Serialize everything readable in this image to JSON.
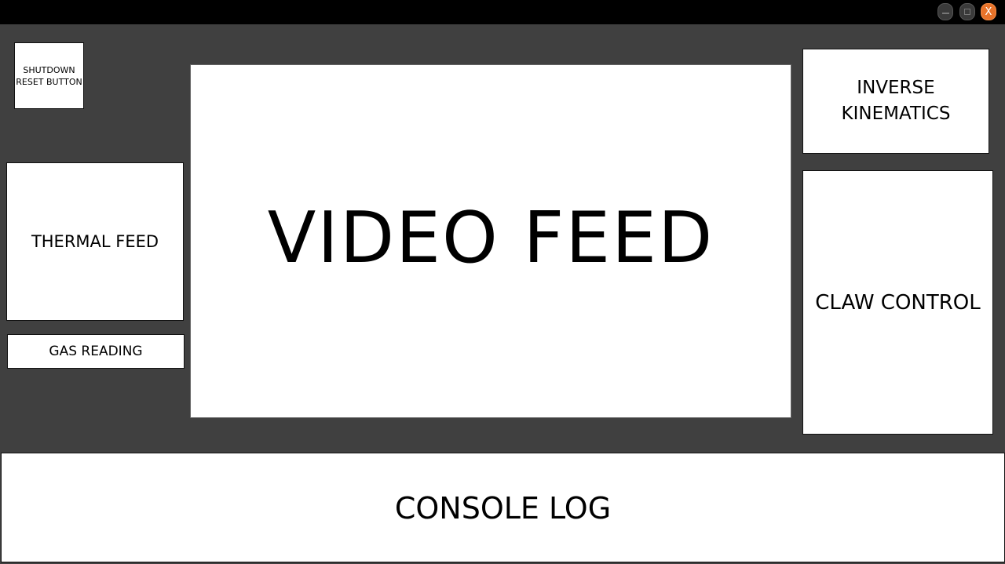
{
  "window": {
    "close_glyph": "X",
    "icons": {
      "minimize": "minimize-icon",
      "maximize": "maximize-icon",
      "close": "close-icon"
    },
    "colors": {
      "titlebar": "#000000",
      "background": "#404040",
      "close_accent": "#e8732a",
      "panel": "#ffffff"
    }
  },
  "panels": {
    "shutdown": {
      "label": "SHUTDOWN\nRESET BUTTON"
    },
    "thermal": {
      "label": "THERMAL FEED"
    },
    "gas": {
      "label": "GAS READING"
    },
    "video": {
      "label": "VIDEO FEED"
    },
    "inverse_kinematics": {
      "label": "INVERSE\nKINEMATICS"
    },
    "claw": {
      "label": "CLAW CONTROL"
    },
    "console": {
      "label": "CONSOLE LOG"
    }
  }
}
